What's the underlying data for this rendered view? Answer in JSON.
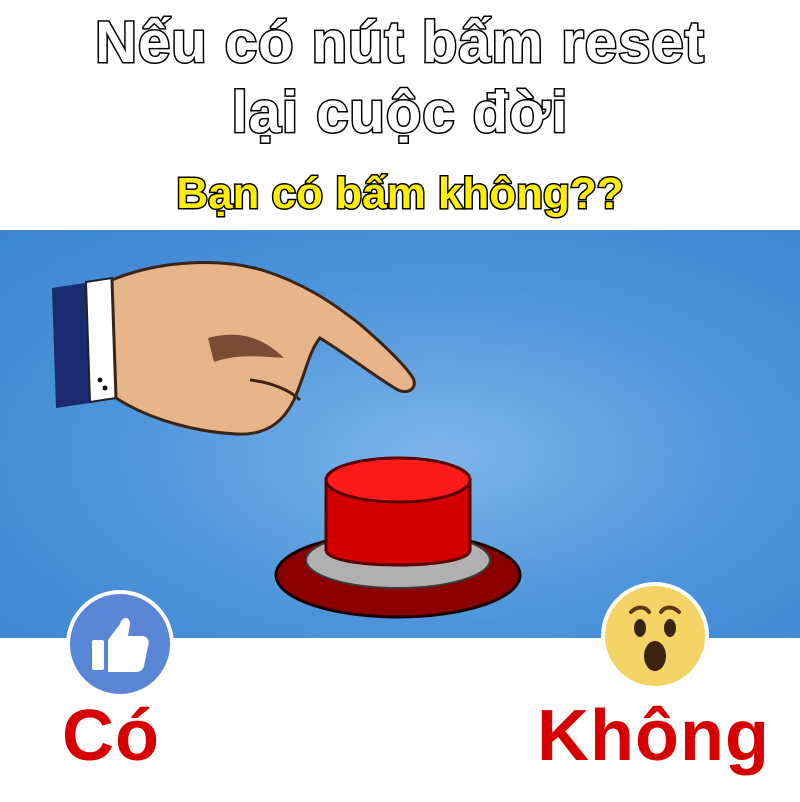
{
  "title": {
    "line1": "Nếu có nút bấm reset",
    "line2": "lại cuộc đời"
  },
  "subtitle": "Bạn có bấm không??",
  "options": {
    "yes": {
      "label": "Có",
      "icon": "thumbs-up-icon",
      "color": "#d60000"
    },
    "no": {
      "label": "Không",
      "icon": "wow-face-icon",
      "color": "#d60000"
    }
  },
  "colors": {
    "background": "#ffffff",
    "scene_blue": "#4b93da",
    "button_red": "#e60000",
    "title_yellow": "#ffee00"
  }
}
